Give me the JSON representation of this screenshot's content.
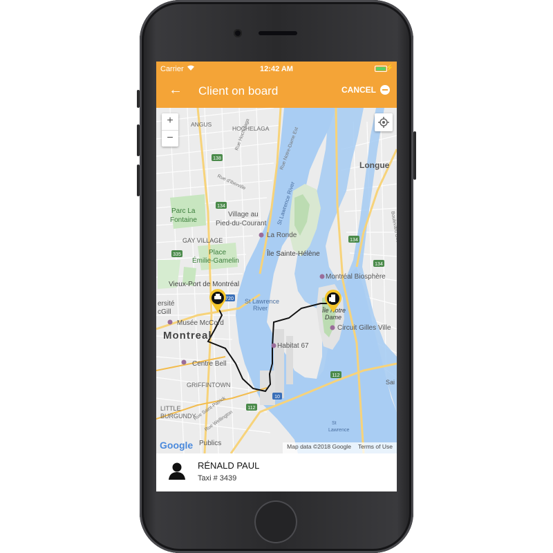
{
  "status_bar": {
    "carrier": "Carrier",
    "time": "12:42 AM"
  },
  "app_bar": {
    "title": "Client on board",
    "cancel_label": "CANCEL",
    "accent_color": "#f4a437"
  },
  "map": {
    "zoom_in": "+",
    "zoom_out": "−",
    "google_logo": "Google",
    "map_data": "Map data ©2018 Google",
    "terms": "Terms of Use",
    "labels": {
      "angus": "ANGUS",
      "hochelaga": "HOCHELAGA",
      "longueuil": "Longue",
      "rue_hochelaga": "Rue Hochelaga",
      "rue_notre_dame": "Rue Notre-Dame Est",
      "rue_iberville": "Rue d'Iberville",
      "parc_la_fontaine_1": "Parc La",
      "parc_la_fontaine_2": "Fontaine",
      "village_1": "Village au",
      "village_2": "Pied-du-Courant",
      "st_lawrence_river_1": "St Lawrence River",
      "la_ronde": "La Ronde",
      "gay_village": "GAY VILLAGE",
      "place_emilie_1": "Place",
      "place_emilie_2": "Émilie-Gamelin",
      "ile_sainte_helene": "Île Sainte-Hélène",
      "montreal_biosphere": "Montréal Biosphère",
      "vieux_port": "Vieux-Port de Montréal",
      "st_lawrence_2a": "St Lawrence",
      "st_lawrence_2b": "River",
      "universite_1": "ersité",
      "universite_2": "cGill",
      "musee_mccord": "Musée McCord",
      "ile_notre_dame_1": "Île Notre",
      "ile_notre_dame_2": "Dame",
      "circuit_gilles": "Circuit Gilles Ville",
      "montreal": "Montreal",
      "habitat_67": "Habitat 67",
      "centre_bell": "Centre Bell",
      "griffintown": "GRIFFINTOWN",
      "little_burgundy_1": "LITTLE",
      "little_burgundy_2": "BURGUNDY",
      "rue_saint_patrick": "Rue Saint-Patrick",
      "rue_wellington": "Rue Wellington",
      "publics": "Publics",
      "st_lawrence_3a": "St",
      "st_lawrence_3b": "Lawrence",
      "boulevard": "Boulevard Desaul",
      "sai": "Sai",
      "route_138": "138",
      "route_134a": "134",
      "route_134b": "134",
      "route_134c": "134",
      "route_335": "335",
      "route_720": "720",
      "route_112a": "112",
      "route_112b": "112",
      "route_10": "10"
    }
  },
  "driver": {
    "name": "RÉNALD PAUL",
    "taxi": "Taxi # 3439"
  }
}
